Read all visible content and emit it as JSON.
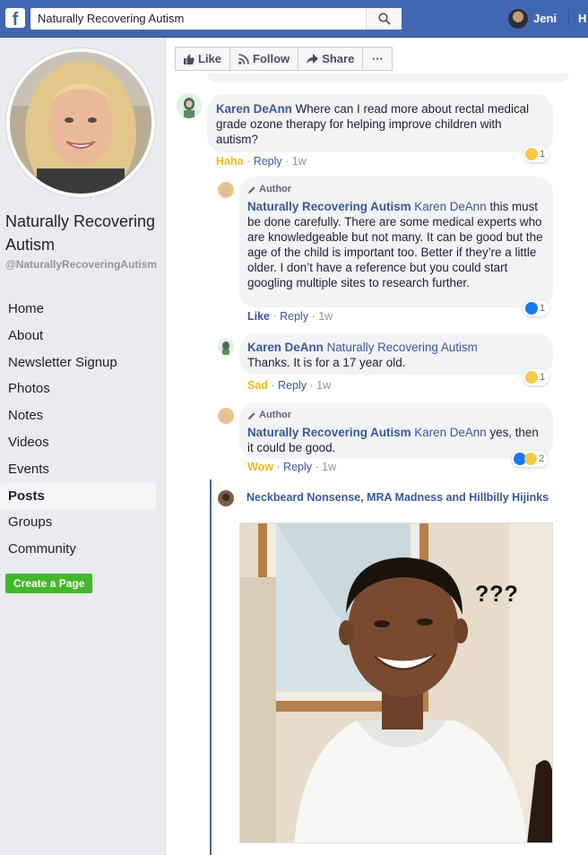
{
  "topbar": {
    "search_value": "Naturally Recovering Autism",
    "user_name": "Jeni",
    "home_label": "H"
  },
  "page": {
    "title": "Naturally Recovering Autism",
    "handle": "@NaturallyRecoveringAutism",
    "nav": [
      "Home",
      "About",
      "Newsletter Signup",
      "Photos",
      "Notes",
      "Videos",
      "Events",
      "Posts",
      "Groups",
      "Community"
    ],
    "active_nav": "Posts",
    "create_page": "Create a Page"
  },
  "actions": {
    "like": "Like",
    "follow": "Follow",
    "share": "Share",
    "more": "···"
  },
  "comments": [
    {
      "author": "Karen DeAnn",
      "text": "Where can I read more about rectal medical grade ozone therapy for helping improve children with autism?",
      "reaction": "Haha",
      "reply": "Reply",
      "time": "1w",
      "count": "1"
    },
    {
      "tag": "Author",
      "author": "Naturally Recovering Autism",
      "mention": "Karen DeAnn",
      "text": "this must be done carefully. There are some medical experts who are knowledgeable but not many. It can be good but the age of the child is important too. Better if they’re a little older. I don’t have a reference but you could start googling multiple sites to research further.",
      "reaction": "Like",
      "reply": "Reply",
      "time": "1w",
      "count": "1"
    },
    {
      "author": "Karen DeAnn",
      "mention": "Naturally Recovering Autism",
      "text": "Thanks. It is for a 17 year old.",
      "reaction": "Sad",
      "reply": "Reply",
      "time": "1w",
      "count": "1"
    },
    {
      "tag": "Author",
      "author": "Naturally Recovering Autism",
      "mention": "Karen DeAnn",
      "text": "yes, then it could be good.",
      "reaction": "Wow",
      "reply": "Reply",
      "time": "1w",
      "count": "2"
    }
  ],
  "shared_reply": {
    "author": "Neckbeard Nonsense, MRA Madness and Hillbilly Hijinks",
    "image_text": "???"
  },
  "colors": {
    "brand": "#4267b2",
    "link": "#385898",
    "haha": "#f0ba15",
    "sad": "#f0ba15",
    "wow": "#f0ba15",
    "like": "#385898"
  }
}
